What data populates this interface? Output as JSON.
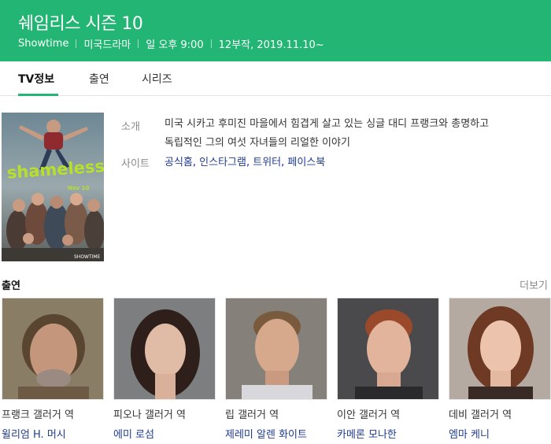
{
  "header": {
    "title": "쉐임리스 시즌 10",
    "meta": [
      "Showtime",
      "미국드라마",
      "일 오후 9:00",
      "12부작, 2019.11.10~"
    ],
    "bg_color": "#22b573"
  },
  "tabs": [
    {
      "label": "TV정보",
      "active": true
    },
    {
      "label": "출연",
      "active": false
    },
    {
      "label": "시리즈",
      "active": false
    }
  ],
  "poster": {
    "logo_text": "shameless",
    "date_text": "Nov 10",
    "network_text": "SHOWTIME"
  },
  "info": {
    "intro_label": "소개",
    "intro_lines": [
      "미국 시카고 후미진 마을에서 힘겹게 살고 있는 싱글 대디 프랭크와 총명하고",
      "독립적인 그의 여섯 자녀들의 리얼한 이야기"
    ],
    "site_label": "사이트",
    "site_links": [
      "공식홈",
      "인스타그램",
      "트위터",
      "페이스북"
    ]
  },
  "cast": {
    "title": "출연",
    "more_label": "더보기",
    "members": [
      {
        "role": "프랭크 갤러거 역",
        "actor": "윌리엄 H. 머시"
      },
      {
        "role": "피오나 갤러거 역",
        "actor": "에미 로섬"
      },
      {
        "role": "립 갤러거 역",
        "actor": "제레미 알렌 화이트"
      },
      {
        "role": "이안 갤러거 역",
        "actor": "카메론 모나한"
      },
      {
        "role": "데비 갤러거 역",
        "actor": "엠마 케니"
      }
    ]
  }
}
